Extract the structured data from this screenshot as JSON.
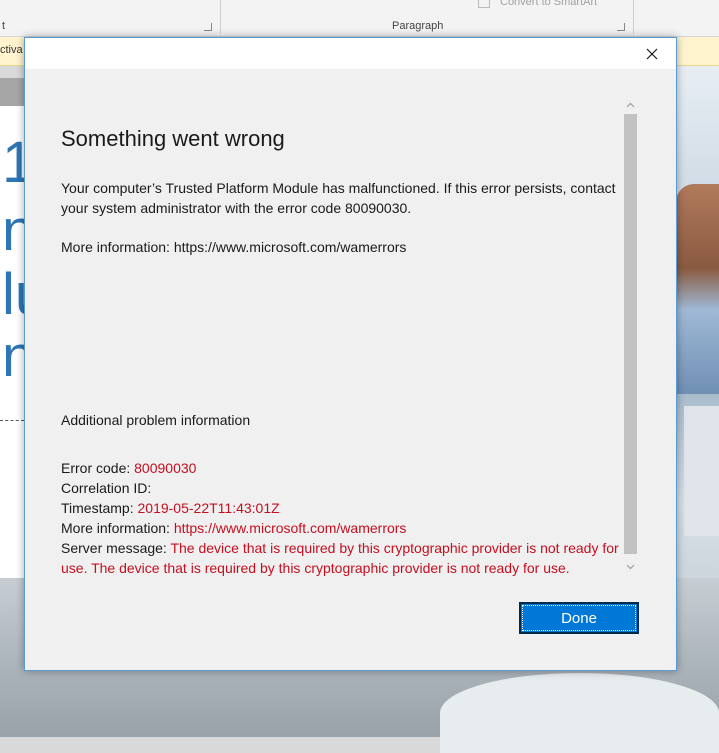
{
  "background": {
    "ribbon": {
      "group_left_label": "t",
      "group_paragraph_label": "Paragraph",
      "convert_smartart_label": "Convert to SmartArt"
    },
    "notice_text": "ctiva",
    "slide_glyphs": [
      "1",
      "n",
      "lu",
      "n"
    ]
  },
  "dialog": {
    "heading": "Something went wrong",
    "message": "Your computer’s Trusted Platform Module has malfunctioned. If this error persists, contact your system administrator with the error code 80090030.",
    "more_info_line": "More information: https://www.microsoft.com/wamerrors",
    "additional_heading": "Additional problem information",
    "details": {
      "error_code_label": "Error code: ",
      "error_code_value": "80090030",
      "correlation_label": "Correlation ID:",
      "timestamp_label": "Timestamp: ",
      "timestamp_value": "2019-05-22T11:43:01Z",
      "more_info_label": "More information: ",
      "more_info_value": "https://www.microsoft.com/wamerrors",
      "server_message_label": "Server message: ",
      "server_message_value": "The device that is required by this cryptographic provider is not ready for use. The device that is required by this cryptographic provider is not ready for use."
    },
    "done_label": "Done",
    "colors": {
      "accent": "#0078d7",
      "error_text": "#c50f1f",
      "dialog_bg": "#f0f0f0"
    }
  }
}
